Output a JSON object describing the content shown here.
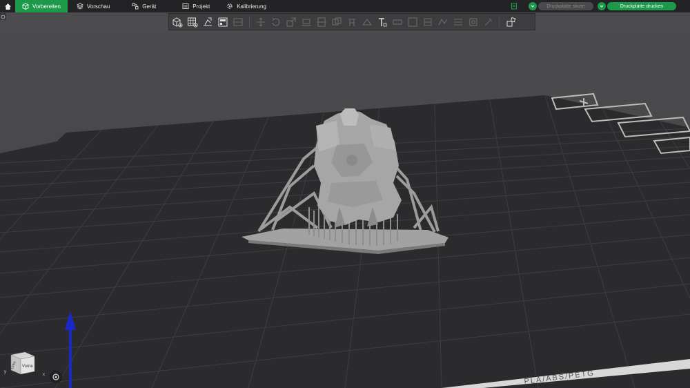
{
  "topbar": {
    "tabs": [
      {
        "label": "Vorbereiten",
        "icon": "cube-icon",
        "active": true
      },
      {
        "label": "Vorschau",
        "icon": "layers-icon",
        "active": false
      },
      {
        "label": "Gerät",
        "icon": "device-icon",
        "active": false
      },
      {
        "label": "Projekt",
        "icon": "project-icon",
        "active": false
      },
      {
        "label": "Kalibrierung",
        "icon": "calibration-icon",
        "active": false
      }
    ],
    "slice_label": "Druckplatte slicen",
    "print_label": "Druckplatte drucken"
  },
  "bed": {
    "label": "PLA/ABS/PETG"
  },
  "view_cube": {
    "top_label": "z",
    "left_label": "Links",
    "front_label": "Vorne",
    "x_label": "x",
    "y_label": "y"
  },
  "colors": {
    "accent": "#1c9a4a",
    "topbar": "#232325",
    "toolbar": "#3d3d3f",
    "background": "#4a4a4d",
    "bed": "#2b2b2d",
    "grid": "#3d3d40",
    "model": "#a8a8a8",
    "axis_z": "#1a28c8"
  }
}
